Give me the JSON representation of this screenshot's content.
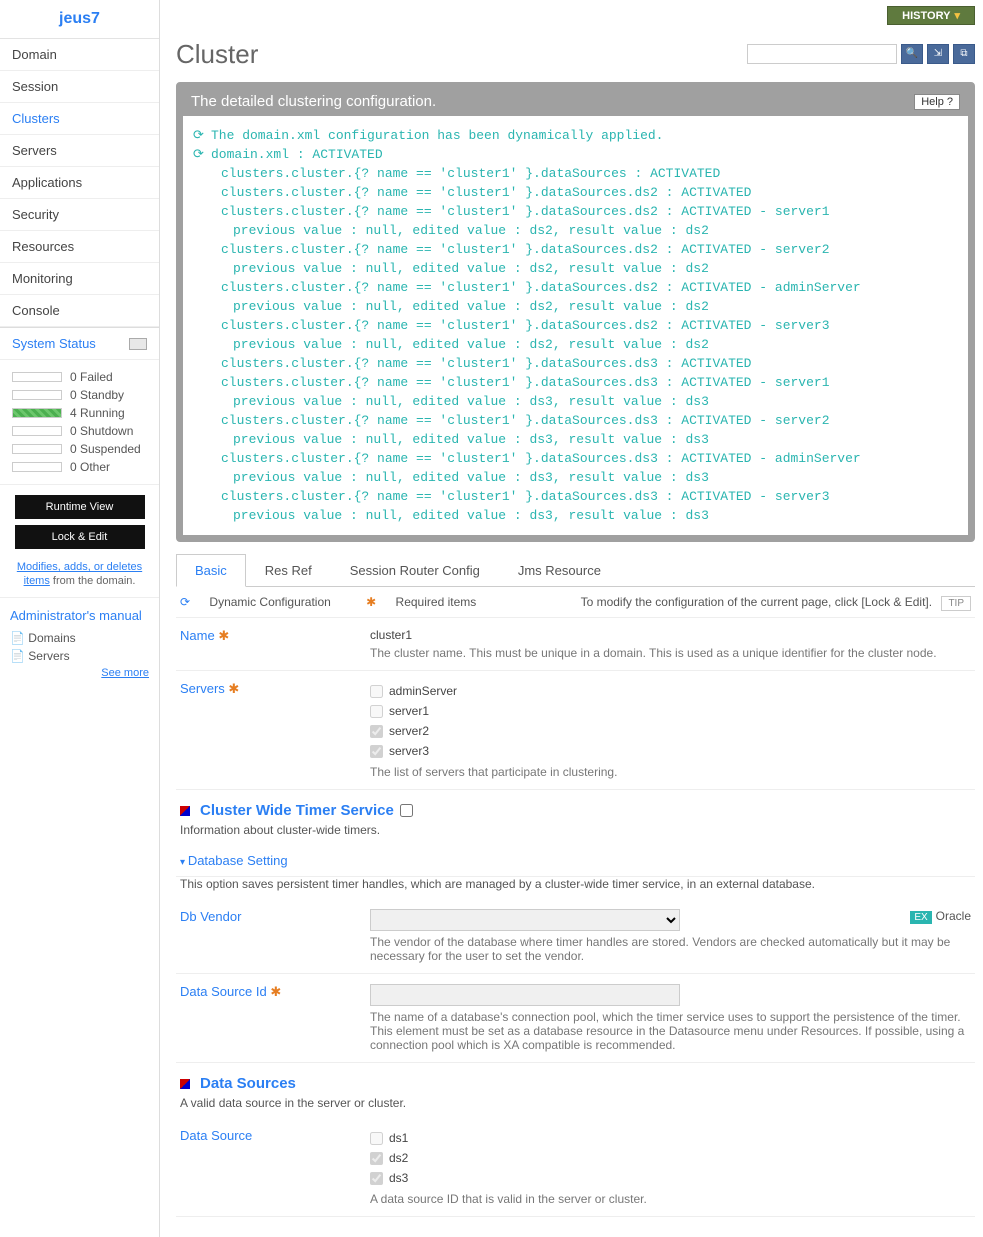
{
  "logo": "jeus7",
  "nav": [
    "Domain",
    "Session",
    "Clusters",
    "Servers",
    "Applications",
    "Security",
    "Resources",
    "Monitoring",
    "Console"
  ],
  "nav_active_index": 2,
  "system_status": {
    "title": "System Status",
    "items": [
      {
        "count": "0",
        "label": "Failed"
      },
      {
        "count": "0",
        "label": "Standby"
      },
      {
        "count": "4",
        "label": "Running"
      },
      {
        "count": "0",
        "label": "Shutdown"
      },
      {
        "count": "0",
        "label": "Suspended"
      },
      {
        "count": "0",
        "label": "Other"
      }
    ]
  },
  "buttons": {
    "runtime_view": "Runtime View",
    "lock_edit": "Lock & Edit"
  },
  "mod_link": "Modifies, adds, or deletes items",
  "mod_suffix": " from the domain.",
  "manual": {
    "title": "Administrator's manual",
    "items": [
      "Domains",
      "Servers"
    ],
    "see_more": "See more"
  },
  "topbar": {
    "history": "HISTORY"
  },
  "page_title": "Cluster",
  "config_panel": {
    "title": "The detailed clustering configuration.",
    "help": "Help",
    "lines": [
      {
        "t": "The domain.xml configuration has been dynamically applied.",
        "i": 0,
        "r": true
      },
      {
        "t": "domain.xml : ACTIVATED",
        "i": 0,
        "r": true
      },
      {
        "t": "clusters.cluster.{? name == 'cluster1' }.dataSources : ACTIVATED",
        "i": 1
      },
      {
        "t": "clusters.cluster.{? name == 'cluster1' }.dataSources.ds2 : ACTIVATED",
        "i": 1
      },
      {
        "t": "clusters.cluster.{? name == 'cluster1' }.dataSources.ds2 : ACTIVATED - server1",
        "i": 1
      },
      {
        "t": "previous value : null, edited value : ds2, result value : ds2",
        "i": 2
      },
      {
        "t": "clusters.cluster.{? name == 'cluster1' }.dataSources.ds2 : ACTIVATED - server2",
        "i": 1
      },
      {
        "t": "previous value : null, edited value : ds2, result value : ds2",
        "i": 2
      },
      {
        "t": "clusters.cluster.{? name == 'cluster1' }.dataSources.ds2 : ACTIVATED - adminServer",
        "i": 1
      },
      {
        "t": "previous value : null, edited value : ds2, result value : ds2",
        "i": 2
      },
      {
        "t": "clusters.cluster.{? name == 'cluster1' }.dataSources.ds2 : ACTIVATED - server3",
        "i": 1
      },
      {
        "t": "previous value : null, edited value : ds2, result value : ds2",
        "i": 2
      },
      {
        "t": "clusters.cluster.{? name == 'cluster1' }.dataSources.ds3 : ACTIVATED",
        "i": 1
      },
      {
        "t": "clusters.cluster.{? name == 'cluster1' }.dataSources.ds3 : ACTIVATED - server1",
        "i": 1
      },
      {
        "t": "previous value : null, edited value : ds3, result value : ds3",
        "i": 2
      },
      {
        "t": "clusters.cluster.{? name == 'cluster1' }.dataSources.ds3 : ACTIVATED - server2",
        "i": 1
      },
      {
        "t": "previous value : null, edited value : ds3, result value : ds3",
        "i": 2
      },
      {
        "t": "clusters.cluster.{? name == 'cluster1' }.dataSources.ds3 : ACTIVATED - adminServer",
        "i": 1
      },
      {
        "t": "previous value : null, edited value : ds3, result value : ds3",
        "i": 2
      },
      {
        "t": "clusters.cluster.{? name == 'cluster1' }.dataSources.ds3 : ACTIVATED - server3",
        "i": 1
      },
      {
        "t": "previous value : null, edited value : ds3, result value : ds3",
        "i": 2
      }
    ]
  },
  "tabs": [
    "Basic",
    "Res Ref",
    "Session Router Config",
    "Jms Resource"
  ],
  "tab_active_index": 0,
  "legend": {
    "dyn": "Dynamic Configuration",
    "req": "Required items",
    "hint": "To modify the configuration of the current page, click [Lock & Edit].",
    "tip": "TIP"
  },
  "form": {
    "name": {
      "label": "Name",
      "value": "cluster1",
      "desc": "The cluster name. This must be unique in a domain. This is used as a unique identifier for the cluster node."
    },
    "servers": {
      "label": "Servers",
      "options": [
        {
          "label": "adminServer",
          "checked": false
        },
        {
          "label": "server1",
          "checked": false
        },
        {
          "label": "server2",
          "checked": true
        },
        {
          "label": "server3",
          "checked": true
        }
      ],
      "desc": "The list of servers that participate in clustering."
    }
  },
  "timer": {
    "title": "Cluster Wide Timer Service",
    "desc": "Information about cluster-wide timers.",
    "db_setting": "Database Setting",
    "db_setting_desc": "This option saves persistent timer handles, which are managed by a cluster-wide timer service, in an external database.",
    "db_vendor": {
      "label": "Db Vendor",
      "example": "Oracle",
      "desc": "The vendor of the database where timer handles are stored. Vendors are checked automatically but it may be necessary for the user to set the vendor."
    },
    "ds_id": {
      "label": "Data Source Id",
      "desc": "The name of a database's connection pool, which the timer service uses to support the persistence of the timer. This element must be set as a database resource in the Datasource menu under Resources. If possible, using a connection pool which is XA compatible is recommended."
    }
  },
  "data_sources": {
    "title": "Data Sources",
    "desc": "A valid data source in the server or cluster.",
    "label": "Data Source",
    "options": [
      {
        "label": "ds1",
        "checked": false
      },
      {
        "label": "ds2",
        "checked": true
      },
      {
        "label": "ds3",
        "checked": true
      }
    ],
    "row_desc": "A data source ID that is valid in the server or cluster."
  }
}
